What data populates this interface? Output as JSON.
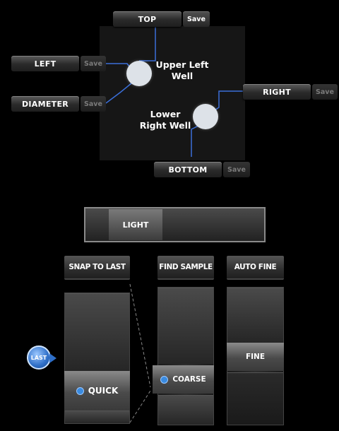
{
  "positions": {
    "top": {
      "label": "TOP",
      "save": "Save"
    },
    "left": {
      "label": "LEFT",
      "save": "Save"
    },
    "diameter": {
      "label": "DIAMETER",
      "save": "Save"
    },
    "right": {
      "label": "RIGHT",
      "save": "Save"
    },
    "bottom": {
      "label": "BOTTOM",
      "save": "Save"
    }
  },
  "wells": {
    "upper_left": {
      "line1": "Upper Left",
      "line2": "Well"
    },
    "lower_right": {
      "line1": "Lower",
      "line2": "Right Well"
    }
  },
  "light": {
    "label": "LIGHT"
  },
  "columns": {
    "snap_to_last": {
      "header": "SNAP TO LAST",
      "selected": "QUICK",
      "badge": "LAST"
    },
    "find_sample": {
      "header": "FIND SAMPLE",
      "selected": "COARSE"
    },
    "auto_fine": {
      "header": "AUTO FINE",
      "selected": "FINE"
    }
  },
  "colors": {
    "accent": "#3a8be0",
    "connector_line": "#3b6fd9"
  }
}
